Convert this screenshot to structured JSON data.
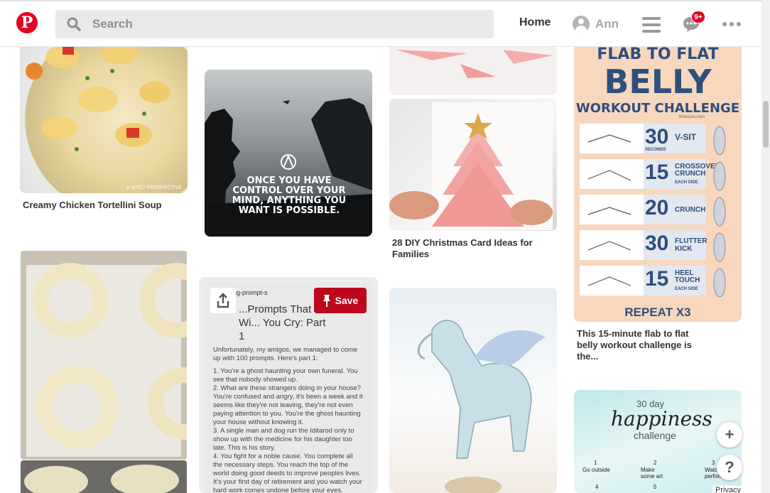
{
  "header": {
    "logo": "P",
    "search_placeholder": "Search",
    "home_label": "Home",
    "user_name": "Ann",
    "notification_badge": "9+"
  },
  "pins": {
    "soup": {
      "caption": "Creamy Chicken Tortellini Soup",
      "watermark": "A SPICY PERSPECTIVE"
    },
    "mind": {
      "quote": "ONCE YOU HAVE CONTROL OVER YOUR MIND, ANYTHING YOU WANT IS POSSIBLE."
    },
    "tree": {
      "caption": "28 DIY Christmas Card Ideas for Families"
    },
    "flab": {
      "title_line1": "FLAB TO FLAT",
      "title_line2": "BELLY",
      "title_line3": "WORKOUT CHALLENGE",
      "site": "fitnessss.com",
      "exercises": [
        {
          "count": "30",
          "name": "V-SIT",
          "note": "SECONDS"
        },
        {
          "count": "15",
          "name": "CROSSOVER CRUNCH",
          "note": "EACH SIDE"
        },
        {
          "count": "20",
          "name": "CRUNCH",
          "note": ""
        },
        {
          "count": "30",
          "name": "FLUTTER KICK",
          "note": ""
        },
        {
          "count": "15",
          "name": "HEEL TOUCH",
          "note": "EACH SIDE"
        }
      ],
      "repeat": "REPEAT X3",
      "caption": "This 15-minute flab to flat belly workout challenge is the..."
    },
    "prompt": {
      "account": "...iting-prompt-s",
      "title": "...Prompts That Wi... You Cry: Part 1",
      "intro": "Unfortunately, my amigos, we managed to come up with 100 prompts. Here's part 1:",
      "items": [
        "1. You're a ghost haunting your own funeral. You see that nobody showed up.",
        "2. What are these strangers doing in your house? You're confused and angry, it's been a week and it seems like they're not leaving, they're not even paying attention to you. You're the ghost haunting your house without knowing it.",
        "3. A single man and dog run the Iditarod only to show up with the medicine for his daughter too late. This is his story.",
        "4. You fight for a noble cause. You complete all the necessary steps. You reach the top of the world doing good deeds to improve peoples lives. It's your first day of retirement and you watch your hard work comes undone before your eyes."
      ],
      "save_label": "Save"
    },
    "happy": {
      "line1": "30 day",
      "line2": "happiness",
      "line3": "challenge",
      "items": [
        "1",
        "Go outside",
        "2",
        "Make some art",
        "3",
        "Watch... perform...",
        "4",
        "5"
      ]
    }
  },
  "fab": {
    "add": "+",
    "help": "?"
  },
  "footer": {
    "privacy": "Privacy"
  },
  "colors": {
    "brand": "#e60023",
    "save": "#bd081c",
    "flab_navy": "#2f4f7d"
  }
}
